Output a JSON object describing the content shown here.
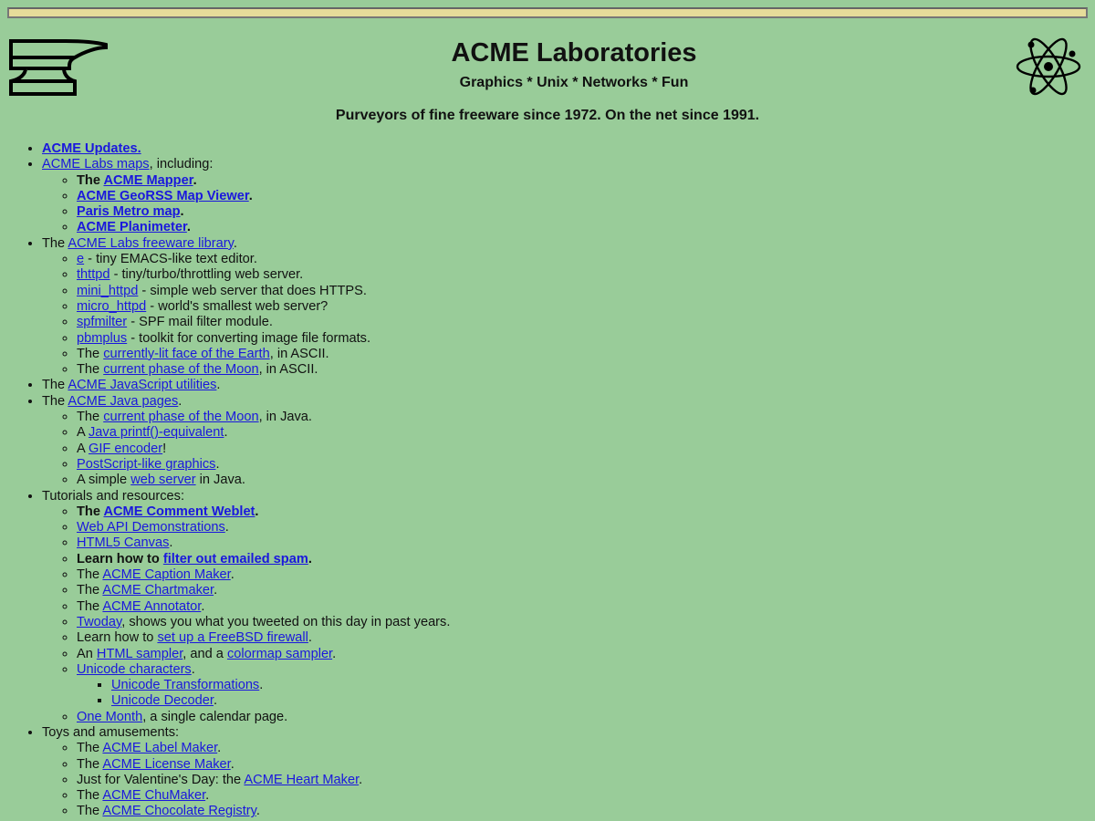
{
  "header": {
    "title": "ACME Laboratories",
    "subtitle": "Graphics * Unix * Networks * Fun",
    "tagline": "Purveyors of fine freeware since 1972. On the net since 1991."
  },
  "items": {
    "updates": "ACME Updates.",
    "maps_link": "ACME Labs maps",
    "maps_suffix": ", including:",
    "mapper_pre": "The ",
    "mapper_link": "ACME Mapper",
    "dot": ".",
    "georss_link": "ACME GeoRSS Map Viewer",
    "paris_link": "Paris Metro map",
    "planimeter_link": "ACME Planimeter",
    "the": "The ",
    "freeware_link": "ACME Labs freeware library",
    "e_link": "e",
    "e_desc": " - tiny EMACS-like text editor.",
    "thttpd_link": "thttpd",
    "thttpd_desc": " - tiny/turbo/throttling web server.",
    "mini_link": "mini_httpd",
    "mini_desc": " - simple web server that does HTTPS.",
    "micro_link": "micro_httpd",
    "micro_desc": " - world's smallest web server?",
    "spf_link": "spfmilter",
    "spf_desc": " - SPF mail filter module.",
    "pbm_link": "pbmplus",
    "pbm_desc": " - toolkit for converting image file formats.",
    "earth_link": "currently-lit face of the Earth",
    "in_ascii": ", in ASCII.",
    "moon_link": "current phase of the Moon",
    "js_link": "ACME JavaScript utilities",
    "java_link": "ACME Java pages",
    "in_java": ", in Java.",
    "a_pre": "A ",
    "printf_link": "Java printf()-equivalent",
    "gif_link": "GIF encoder",
    "excl": "!",
    "postscript_link": "PostScript-like graphics",
    "simple_pre": "A simple ",
    "webserver_link": "web server",
    "in_java_dot": " in Java.",
    "tutorials": "Tutorials and resources:",
    "comment_link": "ACME Comment Weblet",
    "webapi_link": "Web API Demonstrations",
    "canvas_link": "HTML5 Canvas",
    "learn_bold": "Learn how to ",
    "spam_link": "filter out emailed spam",
    "caption_link": "ACME Caption Maker",
    "chart_link": "ACME Chartmaker",
    "annotator_link": "ACME Annotator",
    "twoday_link": "Twoday",
    "twoday_desc": ", shows you what you tweeted on this day in past years.",
    "learn_plain": "Learn how to ",
    "firewall_link": "set up a FreeBSD firewall",
    "an_pre": "An ",
    "htmlsampler_link": "HTML sampler",
    "and_a": ", and a ",
    "colormap_link": "colormap sampler",
    "unicode_link": "Unicode characters",
    "unitrans_link": "Unicode Transformations",
    "unidecoder_link": "Unicode Decoder",
    "onemonth_link": "One Month",
    "onemonth_desc": ", a single calendar page.",
    "toys": "Toys and amusements:",
    "label_link": "ACME Label Maker",
    "license_link": "ACME License Maker",
    "valentine_pre": "Just for Valentine's Day: the ",
    "heart_link": "ACME Heart Maker",
    "chu_link": "ACME ChuMaker",
    "choc_link": "ACME Chocolate Registry"
  }
}
